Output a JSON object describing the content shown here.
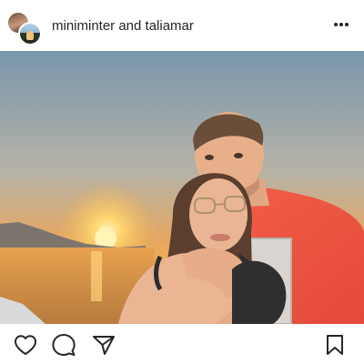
{
  "post": {
    "header": {
      "usernames": "miniminter and taliamar",
      "more_icon": "more-horizontal-icon"
    },
    "actions": {
      "like_icon": "heart-icon",
      "comment_icon": "comment-icon",
      "share_icon": "send-icon",
      "save_icon": "bookmark-icon"
    }
  }
}
